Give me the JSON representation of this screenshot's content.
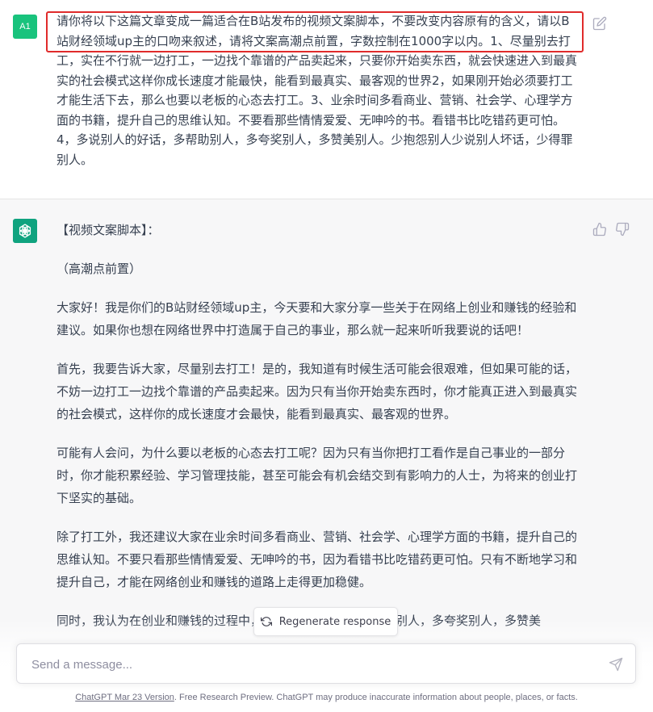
{
  "user_message": {
    "avatar_label": "A1",
    "text": "请你将以下这篇文章变成一篇适合在B站发布的视频文案脚本，不要改变内容原有的含义，请以B站财经领域up主的口吻来叙述，请将文案高潮点前置，字数控制在1000字以内。1、尽量别去打工，实在不行就一边打工，一边找个靠谱的产品卖起来，只要你开始卖东西，就会快速进入到最真实的社会模式这样你成长速度才能最快，能看到最真实、最客观的世界2，如果刚开始必须要打工才能生活下去，那么也要以老板的心态去打工。3、业余时间多看商业、营销、社会学、心理学方面的书籍，提升自己的思维认知。不要看那些情情爱爱、无呻吟的书。看错书比吃错药更可怕。4，多说别人的好话，多帮助别人，多夸奖别人，多赞美别人。少抱怨别人少说别人坏话，少得罪别人。"
  },
  "assistant_message": {
    "paragraphs": [
      "【视频文案脚本】：",
      "（高潮点前置）",
      "大家好！我是你们的B站财经领域up主，今天要和大家分享一些关于在网络上创业和赚钱的经验和建议。如果你也想在网络世界中打造属于自己的事业，那么就一起来听听我要说的话吧！",
      "首先，我要告诉大家，尽量别去打工！是的，我知道有时候生活可能会很艰难，但如果可能的话，不妨一边打工一边找个靠谱的产品卖起来。因为只有当你开始卖东西时，你才能真正进入到最真实的社会模式，这样你的成长速度才会最快，能看到最真实、最客观的世界。",
      "可能有人会问，为什么要以老板的心态去打工呢？因为只有当你把打工看作是自己事业的一部分时，你才能积累经验、学习管理技能，甚至可能会有机会结交到有影响力的人士，为将来的创业打下坚实的基础。",
      "除了打工外，我还建议大家在业余时间多看商业、营销、社会学、心理学方面的书籍，提升自己的思维认知。不要只看那些情情爱爱、无呻吟的书，因为看错书比吃错药更可怕。只有不断地学习和提升自己，才能在网络创业和赚钱的道路上走得更加稳健。",
      "同时，我认为在创业和赚钱的过程中，多说别人的好话，多帮助别人，多夸奖别人，多赞美"
    ]
  },
  "regenerate_label": "Regenerate response",
  "composer": {
    "placeholder": "Send a message..."
  },
  "footer": {
    "link_text": "ChatGPT Mar 23 Version",
    "text": ". Free Research Preview. ChatGPT may produce inaccurate information about people, places, or facts."
  },
  "colors": {
    "highlight": "#e02b2b",
    "brand": "#10a37f",
    "user_avatar": "#19c37d"
  }
}
